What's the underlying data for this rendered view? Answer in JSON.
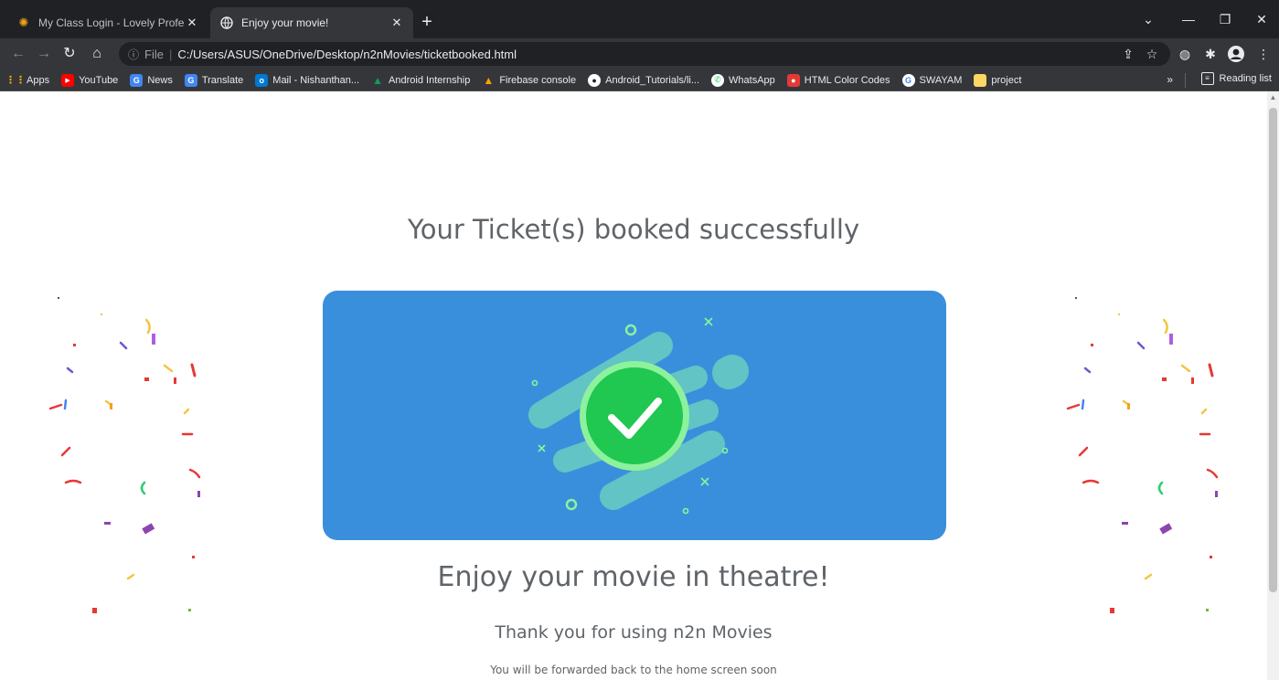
{
  "tabs": [
    {
      "title": "My Class Login - Lovely Professio",
      "favicon": "sun-logo-icon",
      "active": false
    },
    {
      "title": "Enjoy your movie!",
      "favicon": "globe-icon",
      "active": true
    }
  ],
  "address_bar": {
    "scheme_label": "File",
    "url": "C:/Users/ASUS/OneDrive/Desktop/n2nMovies/ticketbooked.html"
  },
  "bookmarks": [
    {
      "label": "Apps",
      "icon": "apps-grid-icon",
      "color": "#f4b400"
    },
    {
      "label": "YouTube",
      "icon": "youtube-icon",
      "color": "#ff0000"
    },
    {
      "label": "News",
      "icon": "news-icon",
      "color": "#4285f4"
    },
    {
      "label": "Translate",
      "icon": "translate-icon",
      "color": "#4285f4"
    },
    {
      "label": "Mail - Nishanthan...",
      "icon": "outlook-icon",
      "color": "#0078d4"
    },
    {
      "label": "Android Internship",
      "icon": "drive-icon",
      "color": "#0f9d58"
    },
    {
      "label": "Firebase console",
      "icon": "firebase-icon",
      "color": "#ffa000"
    },
    {
      "label": "Android_Tutorials/li...",
      "icon": "github-icon",
      "color": "#ffffff"
    },
    {
      "label": "WhatsApp",
      "icon": "whatsapp-icon",
      "color": "#25d366"
    },
    {
      "label": "HTML Color Codes",
      "icon": "color-codes-icon",
      "color": "#e53935"
    },
    {
      "label": "SWAYAM",
      "icon": "google-icon",
      "color": "#ffffff"
    },
    {
      "label": "project",
      "icon": "folder-icon",
      "color": "#fdd663"
    }
  ],
  "bookmarks_more": "»",
  "reading_list": "Reading list",
  "page": {
    "headline": "Your Ticket(s) booked successfully",
    "enjoy": "Enjoy your movie in theatre!",
    "thanks": "Thank you for using n2n Movies",
    "forward": "You will be forwarded back to the home screen soon"
  },
  "colors": {
    "hero_bg": "#3a8fdc",
    "check_green": "#20c750",
    "stripe_teal": "#62c4c4",
    "ring_green": "#8cf29c",
    "text_gray": "#5f6469"
  }
}
